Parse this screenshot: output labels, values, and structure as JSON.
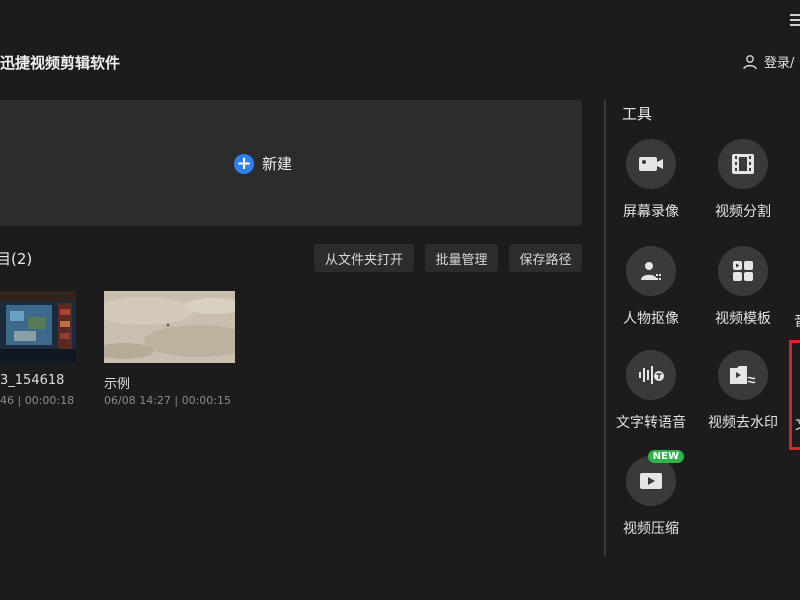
{
  "app": {
    "title": "迅捷视频剪辑软件",
    "login_label": "登录/"
  },
  "create": {
    "new_label": "新建"
  },
  "projects": {
    "heading": "目(2)",
    "buttons": {
      "open_folder": "从文件夹打开",
      "batch_manage": "批量管理",
      "save_path": "保存路径"
    },
    "items": [
      {
        "name": "3_154618",
        "meta": "46 | 00:00:18"
      },
      {
        "name": "示例",
        "meta": "06/08 14:27 | 00:00:15"
      }
    ]
  },
  "tools": {
    "heading": "工具",
    "items": [
      {
        "label": "屏幕录像",
        "icon": "screen-record-icon"
      },
      {
        "label": "视频分割",
        "icon": "film-icon"
      },
      {
        "label": "人物抠像",
        "icon": "person-cutout-icon"
      },
      {
        "label": "视频模板",
        "icon": "template-icon"
      },
      {
        "label": "文字转语音",
        "icon": "text-to-speech-icon"
      },
      {
        "label": "视频去水印",
        "icon": "watermark-remove-icon"
      },
      {
        "label": "视频压缩",
        "icon": "compress-icon",
        "badge": "NEW"
      }
    ],
    "cut_labels": [
      "音",
      "文"
    ]
  },
  "colors": {
    "accent": "#2f7ff0",
    "badge": "#2fb24a",
    "highlight": "#e0202a",
    "background": "#1c1c1c"
  }
}
